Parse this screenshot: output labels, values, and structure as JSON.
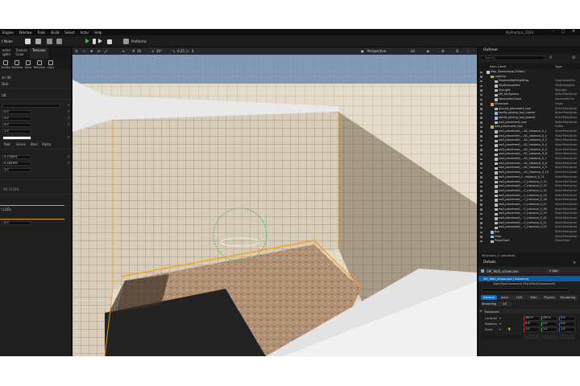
{
  "menu": {
    "items": [
      "Engine",
      "Window",
      "Tools",
      "Build",
      "Select",
      "Actor",
      "Help"
    ],
    "project_title": "MyPractice_2024"
  },
  "toolbar": {
    "mode_label": "t Mode",
    "platforms_label": "Platforms"
  },
  "left_panel": {
    "tabs": [
      "ector\nights",
      "Texture\nColor",
      "Textures"
    ],
    "tools": [
      "Tacility",
      "Tacilehk",
      "Save",
      "Remove",
      "Copy"
    ],
    "rows": [
      "str 00",
      "Disk",
      "UB"
    ],
    "color_values": [
      "0.0",
      "0.0",
      "0.0",
      "1.0"
    ],
    "channels": [
      "Red",
      "Green",
      "Blue",
      "Alpha"
    ],
    "lower_values": [
      "0.270091",
      "0.165399",
      "1.0"
    ],
    "lower_extra": "96.31346",
    "lods_label": "l LODs",
    "lods_value": "0.0"
  },
  "viewport": {
    "perspective_label": "Perspective",
    "lit_label": "Lit",
    "grid_value": "10",
    "angle_value": "10°",
    "scale_value": "0.25",
    "camera_speed": "4"
  },
  "outliner": {
    "title": "Outliner",
    "search_placeholder": "Search...",
    "col_label": "Item Label",
    "col_type": "Type",
    "footer": "99 actors (1 selected)",
    "rows": [
      {
        "label": "Map_Showcasing (Editor)",
        "type": "",
        "indent": 0,
        "kind": "world"
      },
      {
        "label": "Lighting",
        "type": "",
        "indent": 1,
        "kind": "folder"
      },
      {
        "label": "ExponentialHeightFog",
        "type": "ExponentialHe",
        "indent": 2,
        "kind": "actor"
      },
      {
        "label": "SkyAtmosphere",
        "type": "SkyAtmospher",
        "indent": 2,
        "kind": "actor"
      },
      {
        "label": "SkyLight",
        "type": "SkyLight",
        "indent": 2,
        "kind": "actor"
      },
      {
        "label": "SM_SkySphere",
        "type": "StaticMeshActor",
        "indent": 2,
        "kind": "actor"
      },
      {
        "label": "VolumetricCloud",
        "type": "VolumetricClo",
        "indent": 2,
        "kind": "actor"
      },
      {
        "label": "Showcase",
        "type": "Folder",
        "indent": 1,
        "kind": "folder"
      },
      {
        "label": "ground_placement_tool",
        "type": "StaticMeshActor",
        "indent": 2,
        "kind": "mesh"
      },
      {
        "label": "tactile_paving_tool_normal",
        "type": "StaticMeshActor",
        "indent": 2,
        "kind": "mesh"
      },
      {
        "label": "tactile_paving_tool_special",
        "type": "StaticMeshActor",
        "indent": 2,
        "kind": "mesh"
      },
      {
        "label": "wall_placement_tool",
        "type": "StaticMeshActor",
        "indent": 2,
        "kind": "mesh"
      },
      {
        "label": "wall_placement_tool",
        "type": "Folder",
        "indent": 1,
        "kind": "folder"
      },
      {
        "label": "wall_placement_...AC_instance_0_1",
        "type": "StaticMeshActor",
        "indent": 2,
        "kind": "actor"
      },
      {
        "label": "wall_placement_...AC_instance_0_2",
        "type": "StaticMeshActor",
        "indent": 2,
        "kind": "actor"
      },
      {
        "label": "wall_placement_...AC_instance_0_3",
        "type": "StaticMeshActor",
        "indent": 2,
        "kind": "actor"
      },
      {
        "label": "wall_placement_...AC_instance_0_4",
        "type": "StaticMeshActor",
        "indent": 2,
        "kind": "actor"
      },
      {
        "label": "wall_placement_...AC_instance_0_5",
        "type": "StaticMeshActor",
        "indent": 2,
        "kind": "actor"
      },
      {
        "label": "wall_placement_...AC_instance_0_6",
        "type": "StaticMeshActor",
        "indent": 2,
        "kind": "actor"
      },
      {
        "label": "wall_placement_...AC_instance_0_7",
        "type": "StaticMeshActor",
        "indent": 2,
        "kind": "actor"
      },
      {
        "label": "wall_placement_...AC_instance_0_8",
        "type": "StaticMeshActor",
        "indent": 2,
        "kind": "actor"
      },
      {
        "label": "wall_placement_...AC_instance_0_9",
        "type": "StaticMeshActor",
        "indent": 2,
        "kind": "actor"
      },
      {
        "label": "wall_placement_...AC_instance_0_10",
        "type": "StaticMeshActor",
        "indent": 2,
        "kind": "actor"
      },
      {
        "label": "wall_placement_t...instance_0_11",
        "type": "StaticMeshActor",
        "indent": 2,
        "kind": "actor"
      },
      {
        "label": "wall_placement_...C_instance_0_12",
        "type": "StaticMeshActor",
        "indent": 2,
        "kind": "actor"
      },
      {
        "label": "wall_placement_...C_instance_0_13",
        "type": "StaticMeshActor",
        "indent": 2,
        "kind": "actor"
      },
      {
        "label": "wall_placement_...C_instance_0_14",
        "type": "StaticMeshActor",
        "indent": 2,
        "kind": "actor"
      },
      {
        "label": "wall_placement_...C_instance_0_15",
        "type": "StaticMeshActor",
        "indent": 2,
        "kind": "actor"
      },
      {
        "label": "wall_placement_...C_instance_0_16",
        "type": "StaticMeshActor",
        "indent": 2,
        "kind": "actor"
      },
      {
        "label": "wall_placement_...C_instance_0_17",
        "type": "StaticMeshActor",
        "indent": 2,
        "kind": "actor"
      },
      {
        "label": "wall_placement_...C_instance_0_18",
        "type": "StaticMeshActor",
        "indent": 2,
        "kind": "actor"
      },
      {
        "label": "wall_placement_...C_instance_0_19",
        "type": "StaticMeshActor",
        "indent": 2,
        "kind": "actor"
      },
      {
        "label": "wall_placement_...C_instance_0_20",
        "type": "StaticMeshActor",
        "indent": 2,
        "kind": "actor"
      },
      {
        "label": "wall_placement_...C_instance_0_21",
        "type": "StaticMeshActor",
        "indent": 2,
        "kind": "actor"
      },
      {
        "label": "wall_placement_...C_instance_0_22",
        "type": "StaticMeshActor",
        "indent": 2,
        "kind": "actor"
      },
      {
        "label": "Box",
        "type": "StaticMeshActor",
        "indent": 1,
        "kind": "mesh"
      },
      {
        "label": "Floor",
        "type": "StaticMeshActor",
        "indent": 1,
        "kind": "mesh"
      },
      {
        "label": "PlayerStart",
        "type": "PlayerStart",
        "indent": 1,
        "kind": "actor"
      }
    ]
  },
  "details": {
    "title": "Details",
    "actor_name": "SM_Wall_showcase",
    "add_label": "+ Add",
    "component_label": "SM_Wall_showcase (Instance)",
    "component_sub": "StaticMeshComponent (StaticMeshComponent0)",
    "filter_tabs": [
      "General",
      "Actor",
      "LOD",
      "Misc",
      "Physics",
      "Rendering"
    ],
    "filter_tabs2": [
      "Streaming",
      "All"
    ],
    "section": "Transform",
    "location_label": "Location",
    "location": [
      "240.0",
      "250.0",
      "0.0"
    ],
    "rotation_label": "Rotation",
    "rotation": [
      "0.0",
      "0.0",
      "0.0"
    ],
    "scale_label": "Scale",
    "scale": [
      "1.0",
      "1.0",
      "1.0"
    ]
  },
  "colors": {
    "accent": "#f6a21a",
    "selection": "#0d5c9e",
    "play_green": "#43b84c",
    "folder": "#c8a464"
  }
}
